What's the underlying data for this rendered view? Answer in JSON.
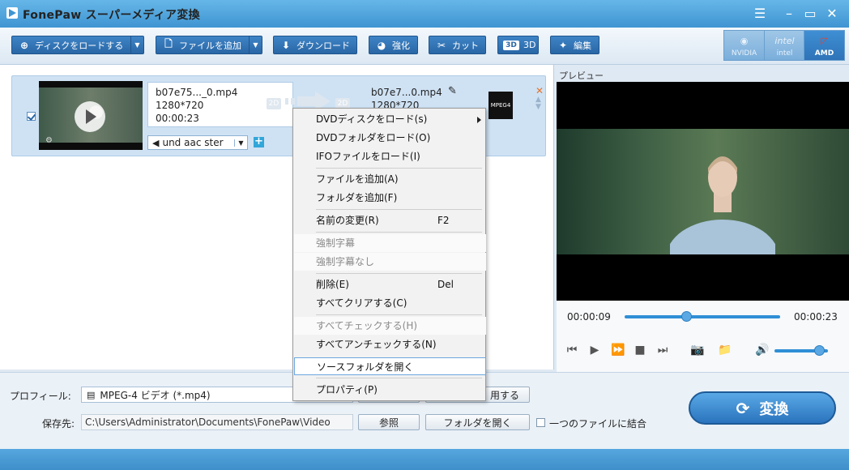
{
  "window": {
    "title": "FonePaw スーパーメディア変換"
  },
  "toolbar": {
    "load_disc": "ディスクをロードする",
    "add_file": "ファイルを追加",
    "download": "ダウンロード",
    "enhance": "強化",
    "cut": "カット",
    "three_d": "3D",
    "three_d_badge": "3D",
    "edit": "編集"
  },
  "gpu": {
    "nvidia": "NVIDIA",
    "intel": "intel",
    "amd": "AMD",
    "intel_logo": "intel"
  },
  "file": {
    "source_name": "b07e75..._0.mp4",
    "source_resolution": "1280*720",
    "source_duration": "00:00:23",
    "output_name": "b07e7...0.mp4",
    "output_resolution": "1280*720",
    "audio_track": "und aac ster",
    "tag_2d": "2D",
    "format_badge": "MPEG4"
  },
  "preview": {
    "label": "プレビュー",
    "current_time": "00:00:09",
    "total_time": "00:00:23",
    "seek_progress": 0.4,
    "volume_level": 0.85
  },
  "bottom": {
    "profile_label": "プロフィール:",
    "profile_value": "MPEG-4 ビデオ (*.mp4)",
    "apply_label": "用する",
    "save_label": "保存先:",
    "save_path": "C:\\Users\\Administrator\\Documents\\FonePaw\\Video",
    "browse_button": "参照",
    "open_folder_button": "フォルダを開く",
    "merge_label": "一つのファイルに結合",
    "convert_button": "変換"
  },
  "context_menu": {
    "items": [
      {
        "label": "DVDディスクをロード(s)",
        "shortcut": "",
        "disabled": false
      },
      {
        "label": "DVDフォルダをロード(O)",
        "shortcut": "",
        "disabled": false
      },
      {
        "label": "IFOファイルをロード(I)",
        "shortcut": "",
        "disabled": false
      },
      {
        "label": "ファイルを追加(A)",
        "shortcut": "",
        "disabled": false
      },
      {
        "label": "フォルダを追加(F)",
        "shortcut": "",
        "disabled": false
      },
      {
        "label": "名前の変更(R)",
        "shortcut": "F2",
        "disabled": false
      },
      {
        "label": "強制字幕",
        "shortcut": "",
        "disabled": true
      },
      {
        "label": "強制字幕なし",
        "shortcut": "",
        "disabled": true
      },
      {
        "label": "削除(E)",
        "shortcut": "Del",
        "disabled": false
      },
      {
        "label": "すべてクリアする(C)",
        "shortcut": "",
        "disabled": false
      },
      {
        "label": "すべてチェックする(H)",
        "shortcut": "",
        "disabled": true
      },
      {
        "label": "すべてアンチェックする(N)",
        "shortcut": "",
        "disabled": false
      },
      {
        "label": "ソースフォルダを開く",
        "shortcut": "",
        "disabled": false
      },
      {
        "label": "プロパティ(P)",
        "shortcut": "",
        "disabled": false
      }
    ]
  },
  "colors": {
    "accent": "#2a67a6",
    "title_bar": "#4aa0da",
    "warning": "#e8732a"
  }
}
